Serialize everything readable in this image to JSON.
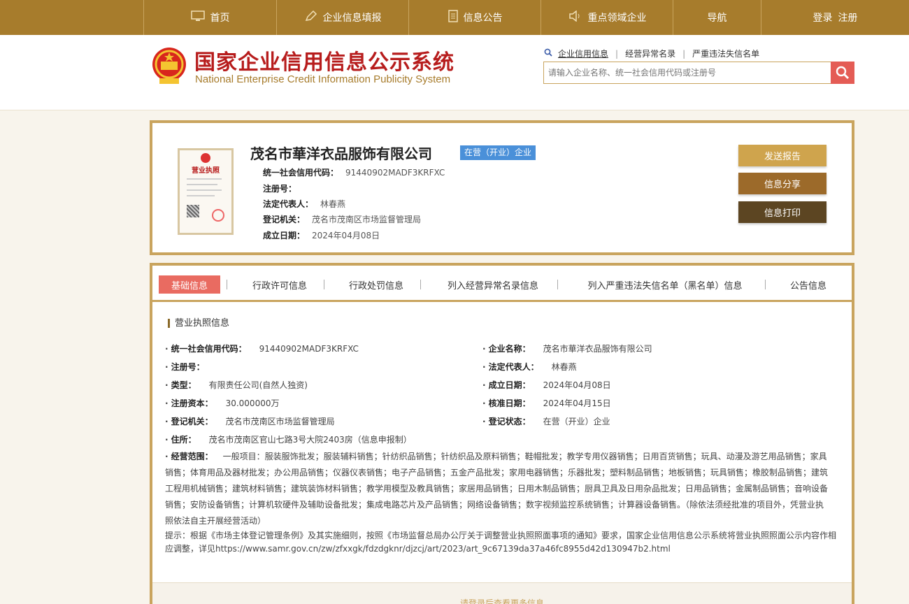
{
  "nav": {
    "items": [
      {
        "label": "首页",
        "icon": "monitor-icon"
      },
      {
        "label": "企业信息填报",
        "icon": "edit-icon"
      },
      {
        "label": "信息公告",
        "icon": "document-icon"
      },
      {
        "label": "重点领域企业",
        "icon": "speaker-icon"
      },
      {
        "label": "导航",
        "icon": ""
      }
    ],
    "login": "登录",
    "register": "注册"
  },
  "header": {
    "title_cn": "国家企业信用信息公示系统",
    "title_en": "National Enterprise Credit Information Publicity System",
    "search_links": [
      "企业信用信息",
      "经营异常名录",
      "严重违法失信名单"
    ],
    "search_placeholder": "请输入企业名称、统一社会信用代码或注册号"
  },
  "company": {
    "name": "茂名市華洋衣品服饰有限公司",
    "status": "在营（开业）企业",
    "license_title": "营业执照",
    "rows": [
      {
        "k": "统一社会信用代码：",
        "v": "91440902MADF3KRFXC"
      },
      {
        "k": "注册号：",
        "v": ""
      },
      {
        "k": "法定代表人：",
        "v": "林春燕"
      },
      {
        "k": "登记机关：",
        "v": "茂名市茂南区市场监督管理局"
      },
      {
        "k": "成立日期：",
        "v": "2024年04月08日"
      }
    ],
    "buttons": {
      "report": "发送报告",
      "share": "信息分享",
      "print": "信息打印"
    }
  },
  "tabs": [
    "基础信息",
    "行政许可信息",
    "行政处罚信息",
    "列入经营异常名录信息",
    "列入严重违法失信名单（黑名单）信息",
    "公告信息"
  ],
  "license_info": {
    "section_title": "营业执照信息",
    "left": [
      {
        "k": "统一社会信用代码：",
        "v": "91440902MADF3KRFXC"
      },
      {
        "k": "注册号：",
        "v": ""
      },
      {
        "k": "类型：",
        "v": "有限责任公司(自然人独资)"
      },
      {
        "k": "注册资本：",
        "v": "30.000000万"
      },
      {
        "k": "登记机关：",
        "v": "茂名市茂南区市场监督管理局"
      },
      {
        "k": "住所：",
        "v": "茂名市茂南区官山七路3号大院2403房（信息申报制）"
      }
    ],
    "right": [
      {
        "k": "企业名称：",
        "v": "茂名市華洋衣品服饰有限公司"
      },
      {
        "k": "法定代表人：",
        "v": "林春燕"
      },
      {
        "k": "成立日期：",
        "v": "2024年04月08日"
      },
      {
        "k": "核准日期：",
        "v": "2024年04月15日"
      },
      {
        "k": "登记状态：",
        "v": "在营（开业）企业"
      }
    ],
    "scope_label": "经营范围：",
    "scope": "一般项目：服装服饰批发；服装辅料销售；针纺织品销售；针纺织品及原料销售；鞋帽批发；教学专用仪器销售；日用百货销售；玩具、动漫及游艺用品销售；家具销售；体育用品及器材批发；办公用品销售；仪器仪表销售；电子产品销售；五金产品批发；家用电器销售；乐器批发；塑料制品销售；地板销售；玩具销售；橡胶制品销售；建筑工程用机械销售；建筑材料销售；建筑装饰材料销售；教学用模型及教具销售；家居用品销售；日用木制品销售；厨具卫具及日用杂品批发；日用品销售；金属制品销售；音响设备销售；安防设备销售；计算机软硬件及辅助设备批发；集成电路芯片及产品销售；网络设备销售；数字视频监控系统销售；计算器设备销售。（除依法须经批准的项目外，凭营业执照依法自主开展经营活动）",
    "tip": "提示：根据《市场主体登记管理条例》及其实施细则，按照《市场监督总局办公厅关于调整营业执照照面事项的通知》要求，国家企业信用信息公示系统将营业执照照面公示内容作相应调整，详见https://www.samr.gov.cn/zw/zfxxgk/fdzdgknr/djzcj/art/2023/art_9c67139da37a46fc8955d42d130947b2.html",
    "more": "请登录后查看更多信息"
  }
}
